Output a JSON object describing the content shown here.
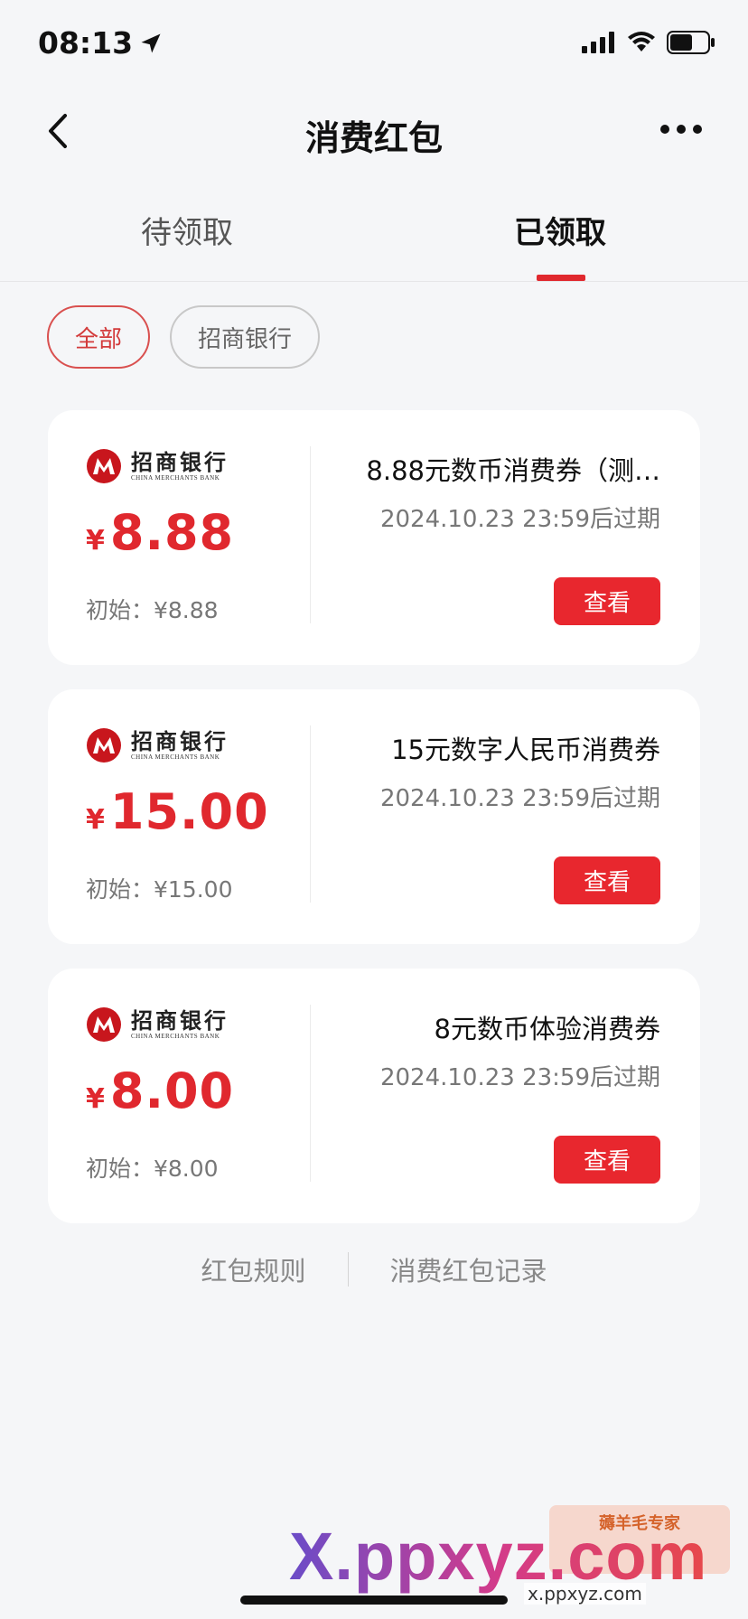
{
  "status": {
    "time": "08:13"
  },
  "nav": {
    "title": "消费红包"
  },
  "tabs": [
    {
      "label": "待领取",
      "active": false
    },
    {
      "label": "已领取",
      "active": true
    }
  ],
  "filters": [
    {
      "label": "全部",
      "active": true
    },
    {
      "label": "招商银行",
      "active": false
    }
  ],
  "bank": {
    "name_cn": "招商银行",
    "name_en": "CHINA MERCHANTS BANK"
  },
  "vouchers": [
    {
      "currency": "¥",
      "amount": "8.88",
      "initial": "初始：¥8.88",
      "title": "8.88元数币消费券（测…",
      "expire": "2024.10.23 23:59后过期",
      "button": "查看"
    },
    {
      "currency": "¥",
      "amount": "15.00",
      "initial": "初始：¥15.00",
      "title": "15元数字人民币消费券",
      "expire": "2024.10.23 23:59后过期",
      "button": "查看"
    },
    {
      "currency": "¥",
      "amount": "8.00",
      "initial": "初始：¥8.00",
      "title": "8元数币体验消费券",
      "expire": "2024.10.23 23:59后过期",
      "button": "查看"
    }
  ],
  "footer": {
    "rules": "红包规则",
    "records": "消费红包记录"
  },
  "watermark": {
    "main": "X.ppxyz.com",
    "sub": "x.ppxyz.com",
    "badge": "薅羊毛专家"
  },
  "colors": {
    "accent": "#e0282e",
    "background": "#f5f6f8"
  }
}
